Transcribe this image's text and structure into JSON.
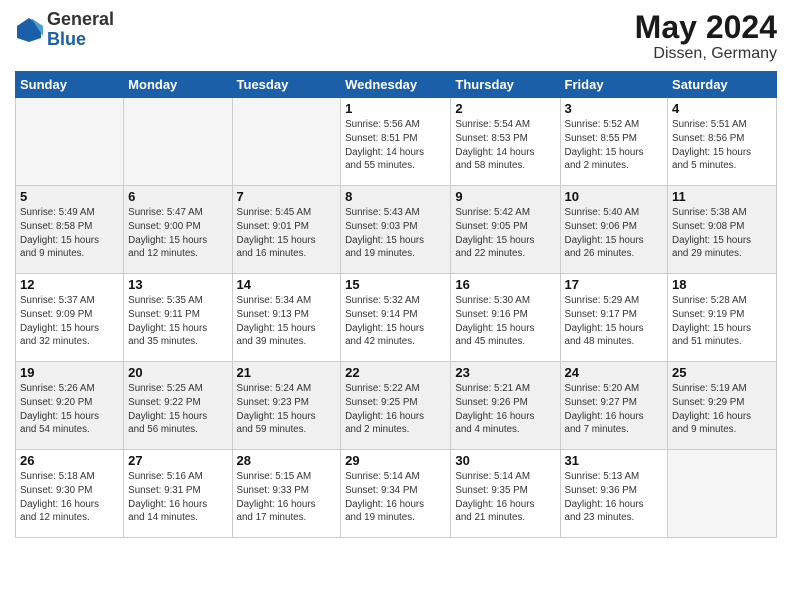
{
  "header": {
    "logo_general": "General",
    "logo_blue": "Blue",
    "month_year": "May 2024",
    "location": "Dissen, Germany"
  },
  "weekdays": [
    "Sunday",
    "Monday",
    "Tuesday",
    "Wednesday",
    "Thursday",
    "Friday",
    "Saturday"
  ],
  "weeks": [
    [
      {
        "day": "",
        "info": ""
      },
      {
        "day": "",
        "info": ""
      },
      {
        "day": "",
        "info": ""
      },
      {
        "day": "1",
        "info": "Sunrise: 5:56 AM\nSunset: 8:51 PM\nDaylight: 14 hours\nand 55 minutes."
      },
      {
        "day": "2",
        "info": "Sunrise: 5:54 AM\nSunset: 8:53 PM\nDaylight: 14 hours\nand 58 minutes."
      },
      {
        "day": "3",
        "info": "Sunrise: 5:52 AM\nSunset: 8:55 PM\nDaylight: 15 hours\nand 2 minutes."
      },
      {
        "day": "4",
        "info": "Sunrise: 5:51 AM\nSunset: 8:56 PM\nDaylight: 15 hours\nand 5 minutes."
      }
    ],
    [
      {
        "day": "5",
        "info": "Sunrise: 5:49 AM\nSunset: 8:58 PM\nDaylight: 15 hours\nand 9 minutes."
      },
      {
        "day": "6",
        "info": "Sunrise: 5:47 AM\nSunset: 9:00 PM\nDaylight: 15 hours\nand 12 minutes."
      },
      {
        "day": "7",
        "info": "Sunrise: 5:45 AM\nSunset: 9:01 PM\nDaylight: 15 hours\nand 16 minutes."
      },
      {
        "day": "8",
        "info": "Sunrise: 5:43 AM\nSunset: 9:03 PM\nDaylight: 15 hours\nand 19 minutes."
      },
      {
        "day": "9",
        "info": "Sunrise: 5:42 AM\nSunset: 9:05 PM\nDaylight: 15 hours\nand 22 minutes."
      },
      {
        "day": "10",
        "info": "Sunrise: 5:40 AM\nSunset: 9:06 PM\nDaylight: 15 hours\nand 26 minutes."
      },
      {
        "day": "11",
        "info": "Sunrise: 5:38 AM\nSunset: 9:08 PM\nDaylight: 15 hours\nand 29 minutes."
      }
    ],
    [
      {
        "day": "12",
        "info": "Sunrise: 5:37 AM\nSunset: 9:09 PM\nDaylight: 15 hours\nand 32 minutes."
      },
      {
        "day": "13",
        "info": "Sunrise: 5:35 AM\nSunset: 9:11 PM\nDaylight: 15 hours\nand 35 minutes."
      },
      {
        "day": "14",
        "info": "Sunrise: 5:34 AM\nSunset: 9:13 PM\nDaylight: 15 hours\nand 39 minutes."
      },
      {
        "day": "15",
        "info": "Sunrise: 5:32 AM\nSunset: 9:14 PM\nDaylight: 15 hours\nand 42 minutes."
      },
      {
        "day": "16",
        "info": "Sunrise: 5:30 AM\nSunset: 9:16 PM\nDaylight: 15 hours\nand 45 minutes."
      },
      {
        "day": "17",
        "info": "Sunrise: 5:29 AM\nSunset: 9:17 PM\nDaylight: 15 hours\nand 48 minutes."
      },
      {
        "day": "18",
        "info": "Sunrise: 5:28 AM\nSunset: 9:19 PM\nDaylight: 15 hours\nand 51 minutes."
      }
    ],
    [
      {
        "day": "19",
        "info": "Sunrise: 5:26 AM\nSunset: 9:20 PM\nDaylight: 15 hours\nand 54 minutes."
      },
      {
        "day": "20",
        "info": "Sunrise: 5:25 AM\nSunset: 9:22 PM\nDaylight: 15 hours\nand 56 minutes."
      },
      {
        "day": "21",
        "info": "Sunrise: 5:24 AM\nSunset: 9:23 PM\nDaylight: 15 hours\nand 59 minutes."
      },
      {
        "day": "22",
        "info": "Sunrise: 5:22 AM\nSunset: 9:25 PM\nDaylight: 16 hours\nand 2 minutes."
      },
      {
        "day": "23",
        "info": "Sunrise: 5:21 AM\nSunset: 9:26 PM\nDaylight: 16 hours\nand 4 minutes."
      },
      {
        "day": "24",
        "info": "Sunrise: 5:20 AM\nSunset: 9:27 PM\nDaylight: 16 hours\nand 7 minutes."
      },
      {
        "day": "25",
        "info": "Sunrise: 5:19 AM\nSunset: 9:29 PM\nDaylight: 16 hours\nand 9 minutes."
      }
    ],
    [
      {
        "day": "26",
        "info": "Sunrise: 5:18 AM\nSunset: 9:30 PM\nDaylight: 16 hours\nand 12 minutes."
      },
      {
        "day": "27",
        "info": "Sunrise: 5:16 AM\nSunset: 9:31 PM\nDaylight: 16 hours\nand 14 minutes."
      },
      {
        "day": "28",
        "info": "Sunrise: 5:15 AM\nSunset: 9:33 PM\nDaylight: 16 hours\nand 17 minutes."
      },
      {
        "day": "29",
        "info": "Sunrise: 5:14 AM\nSunset: 9:34 PM\nDaylight: 16 hours\nand 19 minutes."
      },
      {
        "day": "30",
        "info": "Sunrise: 5:14 AM\nSunset: 9:35 PM\nDaylight: 16 hours\nand 21 minutes."
      },
      {
        "day": "31",
        "info": "Sunrise: 5:13 AM\nSunset: 9:36 PM\nDaylight: 16 hours\nand 23 minutes."
      },
      {
        "day": "",
        "info": ""
      }
    ]
  ]
}
